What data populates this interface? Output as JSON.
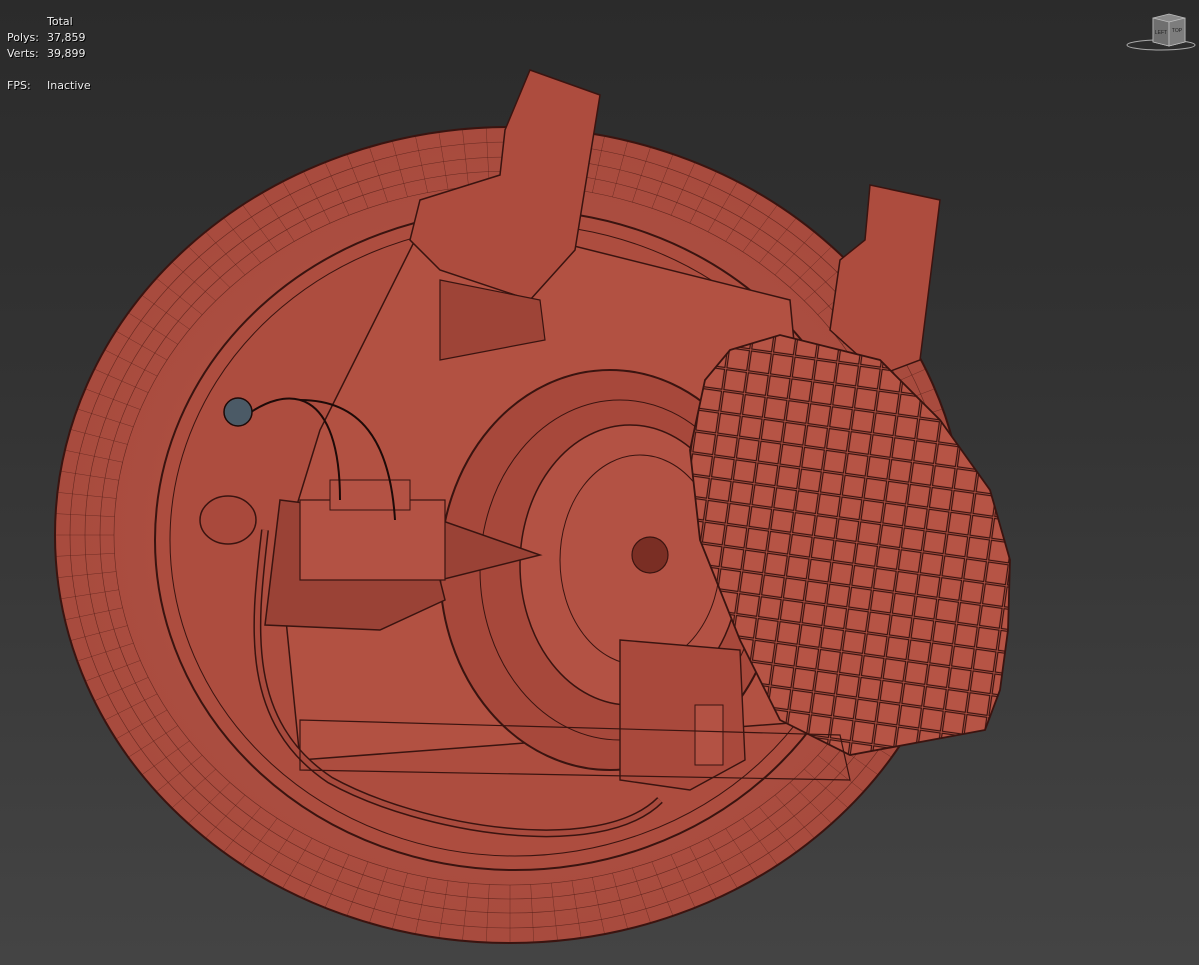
{
  "viewport": {
    "stats": {
      "header": "Total",
      "polys_label": "Polys:",
      "polys_value": "37,859",
      "verts_label": "Verts:",
      "verts_value": "39,899",
      "fps_label": "FPS:",
      "fps_value": "Inactive"
    },
    "viewcube": {
      "left_face": "LEFT",
      "top_face": "TOP"
    }
  },
  "colors": {
    "model_fill": "#b04f40",
    "wireframe": "#3a1410",
    "background_top": "#2b2b2b",
    "background_bottom": "#444444"
  }
}
